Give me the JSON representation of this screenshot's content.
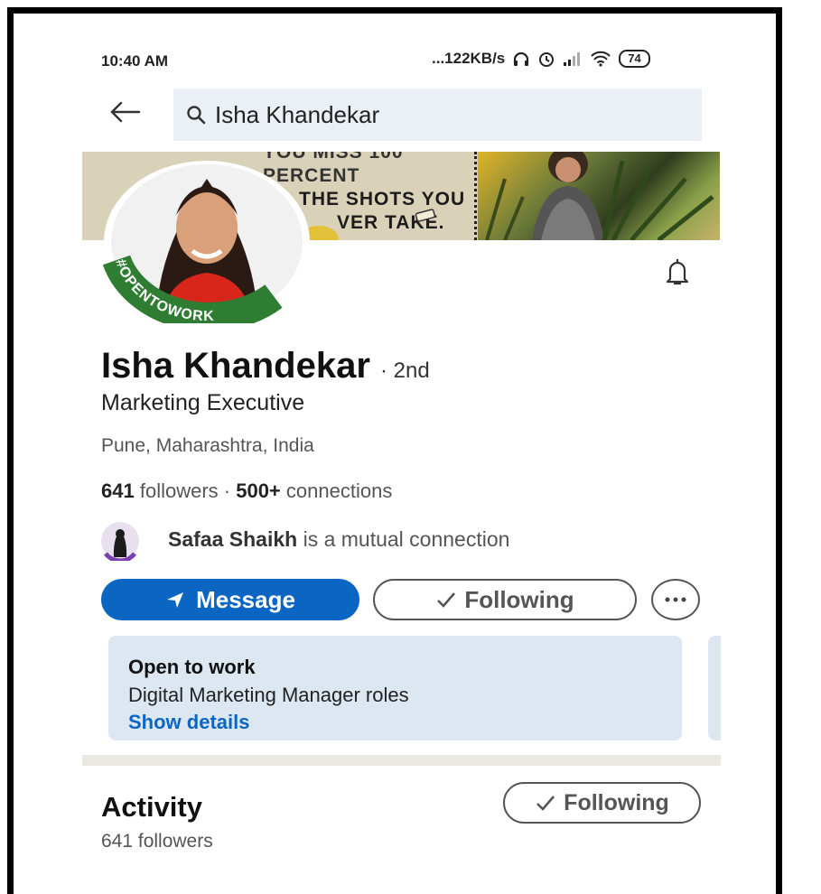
{
  "status_bar": {
    "time": "10:40 AM",
    "speed": "...122KB/s",
    "battery": "74"
  },
  "search": {
    "query": "Isha Khandekar"
  },
  "banner": {
    "line1": "YOU MISS 100 PERCENT",
    "line2": "THE SHOTS YOU",
    "line3": "VER TAKE."
  },
  "profile": {
    "badge": "#OPENTOWORK",
    "name": "Isha Khandekar",
    "degree": "· 2nd",
    "headline": "Marketing Executive",
    "location": "Pune, Maharashtra, India",
    "followers_count": "641",
    "followers_label": "followers ·",
    "connections_count": "500+",
    "connections_label": "connections"
  },
  "mutual": {
    "name": "Safaa Shaikh",
    "suffix": "is a mutual connection"
  },
  "actions": {
    "message_label": "Message",
    "following_label": "Following"
  },
  "open_to_work": {
    "title": "Open to work",
    "description": "Digital Marketing Manager roles",
    "link": "Show details"
  },
  "activity": {
    "title": "Activity",
    "followers": "641 followers",
    "following_label": "Following"
  },
  "colors": {
    "brand_blue": "#0a66c2",
    "card_bg": "#dde7f1",
    "opentowork_green": "#2e7d32"
  }
}
